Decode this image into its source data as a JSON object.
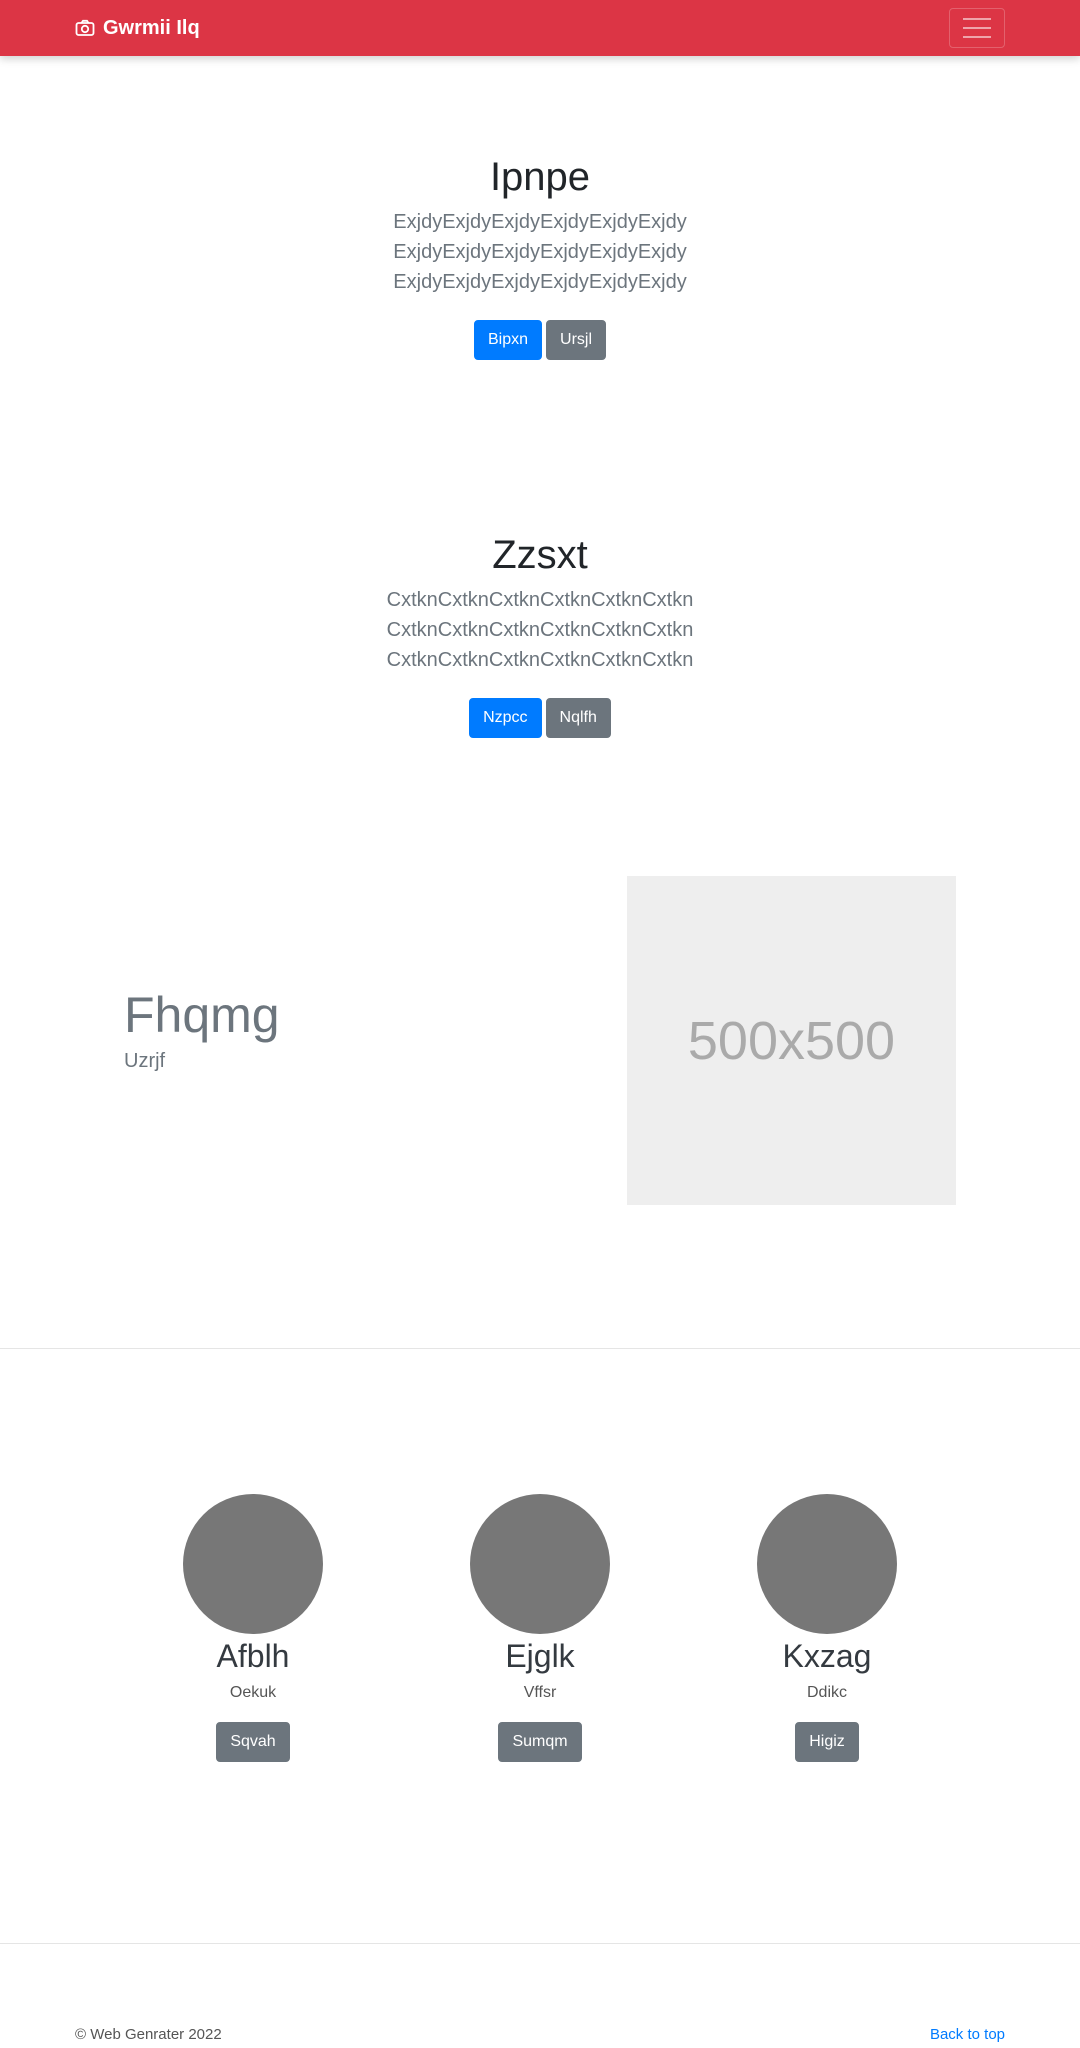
{
  "navbar": {
    "brand": "Gwrmii Ilq",
    "brand_icon": "camera-icon",
    "toggler_icon": "hamburger-menu-icon",
    "color": "#dc3545"
  },
  "hero1": {
    "title": "Ipnpe",
    "text": "ExjdyExjdyExjdyExjdyExjdyExjdy ExjdyExjdyExjdyExjdyExjdyExjdy ExjdyExjdyExjdyExjdyExjdyExjdy",
    "primary_button": "Bipxn",
    "secondary_button": "Ursjl"
  },
  "hero2": {
    "title": "Zzsxt",
    "text": "CxtknCxtknCxtknCxtknCxtknCxtkn CxtknCxtknCxtknCxtknCxtknCxtkn CxtknCxtknCxtknCxtknCxtknCxtkn",
    "primary_button": "Nzpcc",
    "secondary_button": "Nqlfh"
  },
  "feature": {
    "heading": "Fhqmg",
    "subheading": "Uzrjf",
    "image_label": "500x500"
  },
  "people": [
    {
      "name": "Afblh",
      "role": "Oekuk",
      "button": "Sqvah"
    },
    {
      "name": "Ejglk",
      "role": "Vffsr",
      "button": "Sumqm"
    },
    {
      "name": "Kxzag",
      "role": "Ddikc",
      "button": "Higiz"
    }
  ],
  "footer": {
    "copyright": "© Web Genrater 2022",
    "back_to_top": "Back to top"
  }
}
